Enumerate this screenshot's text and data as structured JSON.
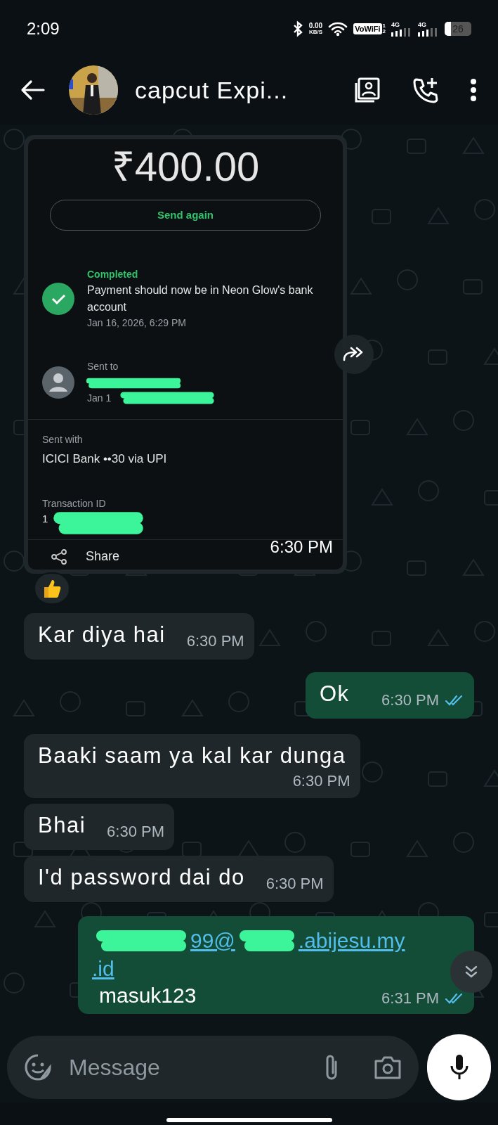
{
  "status_bar": {
    "time": "2:09",
    "data_rate_value": "0.00",
    "data_rate_unit": "KB/S",
    "vowifi": "VoWiFi",
    "sim_1": "1",
    "sim_2": "2",
    "network_1": "4G",
    "network_2": "4G",
    "battery": "26"
  },
  "header": {
    "contact_name": "capcut Expi..."
  },
  "messages": [
    {
      "kind": "payment_in",
      "amount": "₹400.00",
      "send_again": "Send again",
      "status": "Completed",
      "status_text": "Payment should now be in Neon Glow's bank account",
      "status_date": "Jan 16, 2026, 6:29 PM",
      "sent_to_label": "Sent to",
      "sent_to_date": "Jan 1",
      "sent_with_label": "Sent with",
      "sent_with_value": "ICICI Bank ••30 via UPI",
      "transaction_label": "Transaction ID",
      "transaction_value": "1",
      "share": "Share",
      "time": "6:30 PM",
      "has_reaction": true
    },
    {
      "kind": "text_in",
      "text": "Kar diya hai",
      "time": "6:30 PM"
    },
    {
      "kind": "text_out",
      "text": "Ok",
      "time": "6:30 PM",
      "read": true
    },
    {
      "kind": "text_in",
      "text": "Baaki saam ya kal kar dunga",
      "time": "6:30 PM"
    },
    {
      "kind": "text_in",
      "text": "Bhai",
      "time": "6:30 PM"
    },
    {
      "kind": "text_in",
      "text": "I'd password dai do",
      "time": "6:30 PM"
    },
    {
      "kind": "link_out",
      "link_parts": [
        "99@",
        ".abijesu.my",
        ".id"
      ],
      "text": "masuk123",
      "time": "6:31 PM",
      "read": true
    }
  ],
  "composer": {
    "placeholder": "Message"
  }
}
